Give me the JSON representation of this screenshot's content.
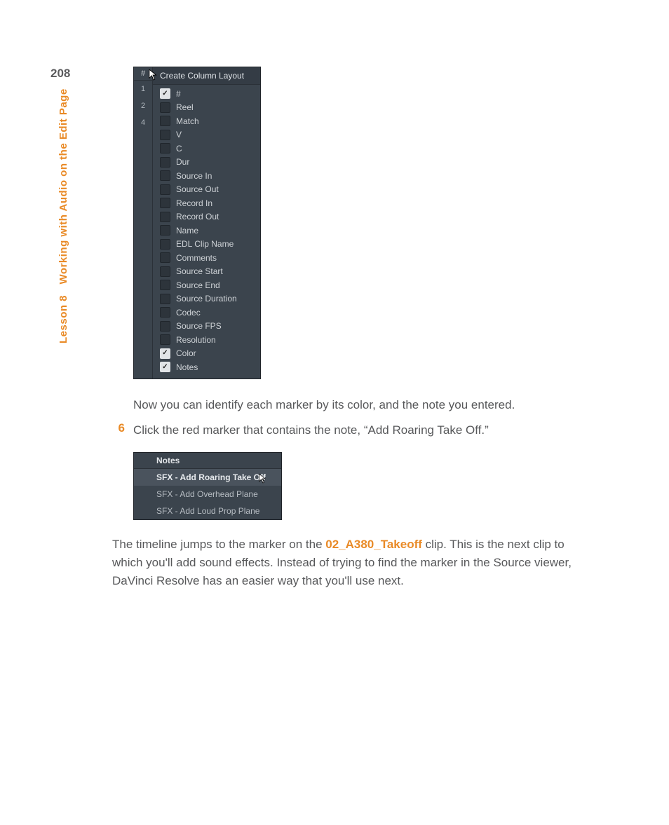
{
  "page_number": "208",
  "side_label": "Lesson 8 Working with Audio on the Edit Page",
  "context_menu": {
    "index_header": "#",
    "row_indices": [
      "1",
      "2",
      "4"
    ],
    "title": "Create Column Layout",
    "items": [
      {
        "label": "#",
        "checked": true
      },
      {
        "label": "Reel",
        "checked": false
      },
      {
        "label": "Match",
        "checked": false
      },
      {
        "label": "V",
        "checked": false
      },
      {
        "label": "C",
        "checked": false
      },
      {
        "label": "Dur",
        "checked": false
      },
      {
        "label": "Source In",
        "checked": false
      },
      {
        "label": "Source Out",
        "checked": false
      },
      {
        "label": "Record In",
        "checked": false
      },
      {
        "label": "Record Out",
        "checked": false
      },
      {
        "label": "Name",
        "checked": false
      },
      {
        "label": "EDL Clip Name",
        "checked": false
      },
      {
        "label": "Comments",
        "checked": false
      },
      {
        "label": "Source Start",
        "checked": false
      },
      {
        "label": "Source End",
        "checked": false
      },
      {
        "label": "Source Duration",
        "checked": false
      },
      {
        "label": "Codec",
        "checked": false
      },
      {
        "label": "Source FPS",
        "checked": false
      },
      {
        "label": "Resolution",
        "checked": false
      },
      {
        "label": "Color",
        "checked": true
      },
      {
        "label": "Notes",
        "checked": true
      }
    ]
  },
  "text_after_menu": "Now you can identify each marker by its color, and the note you entered.",
  "step6_num": "6",
  "step6_text": "Click the red marker that contains the note, “Add Roaring Take Off.”",
  "notes_panel": {
    "header": "Notes",
    "rows": [
      {
        "text": "SFX - Add Roaring Take Off",
        "selected": true
      },
      {
        "text": "SFX - Add Overhead Plane",
        "selected": false
      },
      {
        "text": "SFX - Add Loud Prop Plane",
        "selected": false
      }
    ]
  },
  "final_para_a": "The timeline jumps to the marker on the ",
  "final_clip": "02_A380_Takeoff",
  "final_para_b": " clip. This is the next clip to which you'll add sound effects. Instead of trying to find the marker in the Source viewer, DaVinci Resolve has an easier way that you'll use next."
}
